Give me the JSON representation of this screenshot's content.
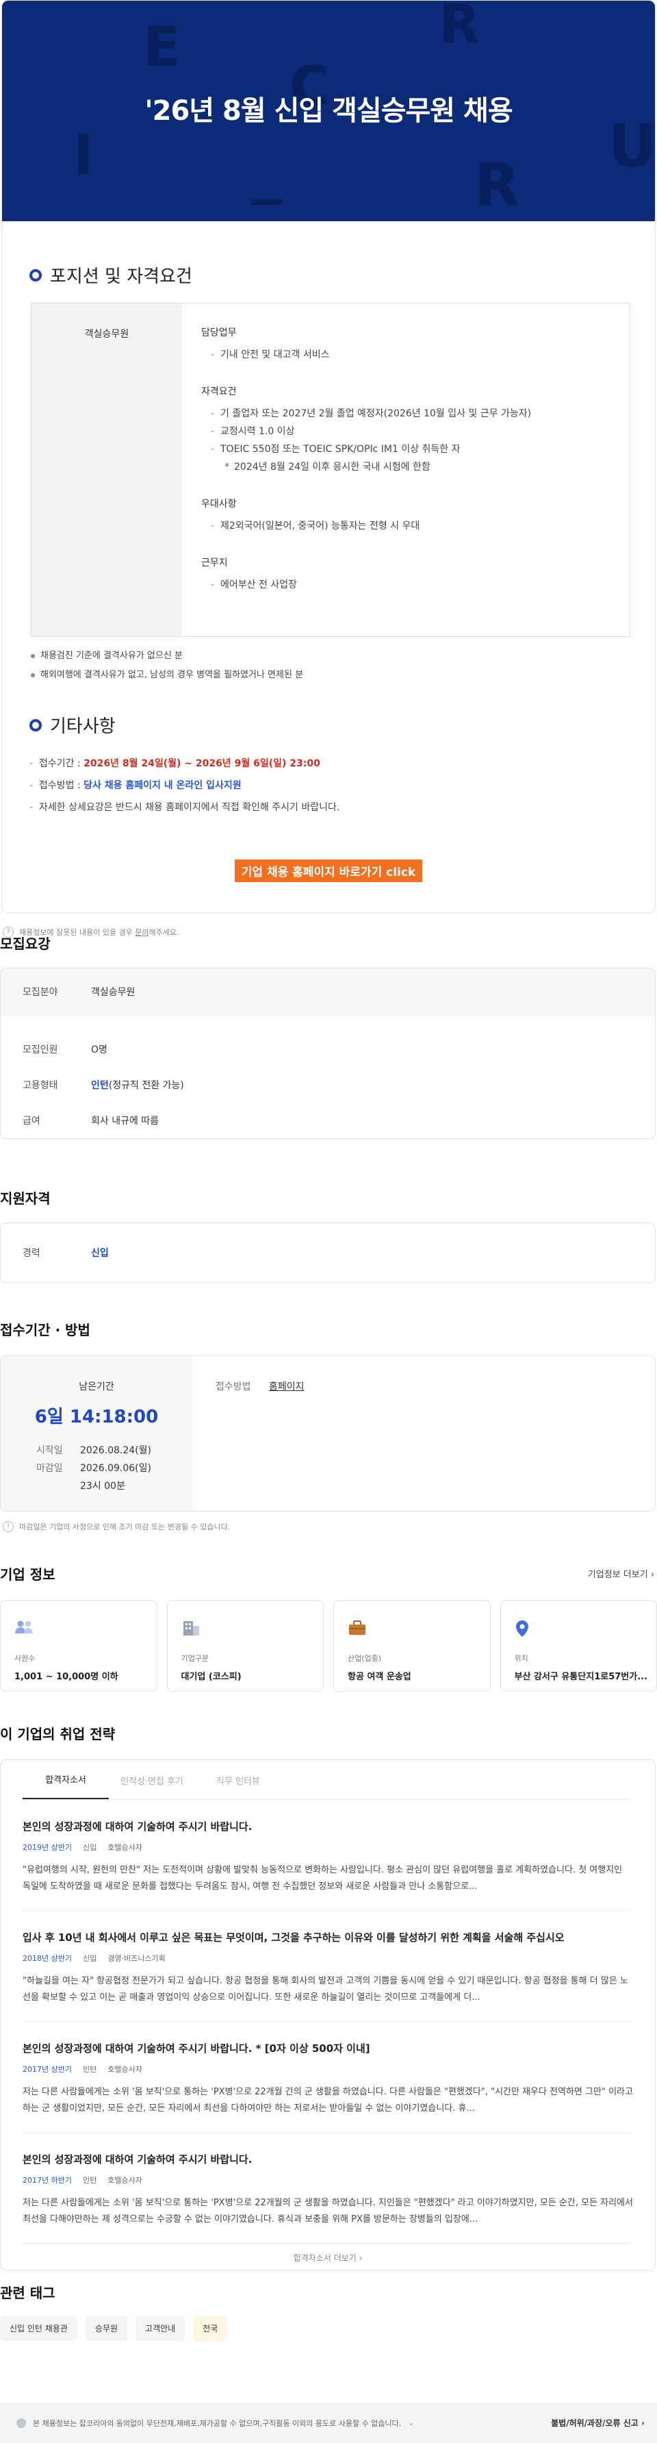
{
  "banner": {
    "title": "'26년 8월 신입 객실승무원 채용",
    "deco_letters": [
      "E",
      "R",
      "C",
      "I",
      "U",
      "R"
    ]
  },
  "positions": {
    "heading": "포지션 및 자격요건",
    "job_name": "객실승무원",
    "duty_title": "담당업무",
    "duty_items": [
      "기내 안전 및 대고객 서비스"
    ],
    "req_title": "자격요건",
    "req_items": [
      "기 졸업자 또는 2027년 2월 졸업 예정자(2026년 10월 입사 및 근무 가능자)",
      "교정시력 1.0 이상",
      "TOEIC 550점 또는 TOEIC SPK/OPIc IM1 이상 취득한 자"
    ],
    "req_sub": "2024년 8월 24일 이후 응시한 국내 시험에 한함",
    "pref_title": "우대사항",
    "pref_items": [
      "제2외국어(일본어, 중국어) 능통자는 전형 시 우대"
    ],
    "loc_title": "근무지",
    "loc_items": [
      "에어부산 전 사업장"
    ],
    "notes": [
      "채용검진 기준에 결격사유가 없으신 분",
      "해외여행에 결격사유가 없고, 남성의 경우 병역을 필하였거나 면제된 분"
    ]
  },
  "etc": {
    "heading": "기타사항",
    "period_label": "접수기간 : ",
    "period_value": "2026년 8월 24일(월) ~ 2026년 9월 6일(일) 23:00",
    "method_label": "접수방법 : ",
    "method_value": "당사 채용 홈페이지 내 온라인 입사지원",
    "detail": "자세한 상세요강은 반드시 채용 홈페이지에서 직접 확인해 주시기 바랍니다.",
    "cta": "기업 채용 홈페이지 바로가기 click"
  },
  "report_line": {
    "pre": "채용정보에 잘못된 내용이 있을 경우 ",
    "link": "문의",
    "post": "해주세요."
  },
  "recruit": {
    "heading": "모집요강",
    "field_label": "모집분야",
    "field_value": "객실승무원",
    "rows": [
      {
        "k": "모집인원",
        "v": "O명"
      },
      {
        "k": "고용형태",
        "v_b": "인턴",
        "v": "(정규직 전환 가능)"
      },
      {
        "k": "급여",
        "v": "회사 내규에 따름"
      }
    ]
  },
  "qualification": {
    "heading": "지원자격",
    "k": "경력",
    "v": "신입"
  },
  "period": {
    "heading": "접수기간 · 방법",
    "remain_label": "남은기간",
    "remain_value": "6일 14:18:00",
    "start_label": "시작일",
    "start_value": "2026.08.24(월)",
    "end_label": "마감일",
    "end_value": "2026.09.06(일)",
    "end_time": "23시 00분",
    "method_label": "접수방법",
    "method_value": "홈페이지",
    "notice": "마감일은 기업의 사정으로 인해 조기 마감 또는 변경될 수 있습니다."
  },
  "company": {
    "heading": "기업 정보",
    "more": "기업정보 더보기",
    "cards": [
      {
        "icon": "people-icon",
        "label": "사원수",
        "value": "1,001 ~ 10,000명 이하"
      },
      {
        "icon": "building-icon",
        "label": "기업구분",
        "value": "대기업 (코스피)"
      },
      {
        "icon": "briefcase-icon",
        "label": "산업(업종)",
        "value": "항공 여객 운송업"
      },
      {
        "icon": "location-pin-icon",
        "label": "위치",
        "value": "부산 강서구 유통단지1로57번가..."
      }
    ]
  },
  "strategy": {
    "heading": "이 기업의 취업 전략",
    "tabs": [
      "합격자소서",
      "인적성·면접 후기",
      "직무 인터뷰"
    ],
    "articles": [
      {
        "title": "본인의 성장과정에 대하여 기술하여 주시기 바랍니다.",
        "year": "2019년 상반기",
        "type": "신입",
        "dept": "호텔승사자",
        "body": "\"유럽여행의 시작, 원헌의 만찬\" 저는 도전적이며 상황에 발맞춰 능동적으로 변화하는 사람입니다. 평소 관심이 많던 유럽여행을 홀로 계획하였습니다. 첫 여행지인 독일에 도착하였을 때 새로운 문화를 접했다는 두려움도 잠시, 여행 전 수집했던 정보와 새로운 사람들과 만나 소통함으로..."
      },
      {
        "title": "입사 후 10년 내 회사에서 이루고 싶은 목표는 무엇이며, 그것을 추구하는 이유와 이를 달성하기 위한 계획을 서술해 주십시오",
        "year": "2018년 상반기",
        "type": "신입",
        "dept": "경영·비즈니스기획",
        "body": "\"하늘길을 여는 자\" 항공협정 전문가가 되고 싶습니다. 항공 협정을 통해 회사의 발전과 고객의 기쁨을 동시에 얻을 수 있기 때문입니다. 항공 협정을 통해 더 많은 노선을 확보할 수 있고 이는 곧 매출과 영업이익 상승으로 이어집니다. 또한 새로운 하늘길이 열리는 것이므로 고객들에게 더..."
      },
      {
        "title": "본인의 성장과정에 대하여 기술하여 주시기 바랍니다. * [0자 이상 500자 이내]",
        "year": "2017년 상반기",
        "type": "인턴",
        "dept": "호텔승사자",
        "body": "저는 다른 사람들에게는 소위 '몸 보직'으로 통하는 'PX병'으로 22개월 간의 군 생활을 하였습니다. 다른 사람들은 \"편했겠다\", \"시간만 재우다 전역하면 그만\" 이라고 하는 군 생활이었지만, 모든 순간, 모든 자리에서 최선을 다하여야만 하는 저로서는 받아들일 수 없는 이야기였습니다. 휴..."
      },
      {
        "title": "본인의 성장과정에 대하여 기술하여 주시기 바랍니다.",
        "year": "2017년 하반기",
        "type": "인턴",
        "dept": "호텔승사자",
        "body": "저는 다른 사람들에게는 소위 '몸 보직'으로 통하는 'PX병'으로 22개월의 군 생활을 하였습니다. 지인들은 \"편했겠다\" 라고 이야기하였지만, 모든 순간, 모든 자리에서 최선을 다해야만하는 제 성격으로는 수긍할 수 없는 이야기였습니다. 휴식과 보충을 위해 PX를 방문하는 장병들의 입장에..."
      }
    ],
    "more": "합격자소서 더보기"
  },
  "tags": {
    "heading": "관련 태그",
    "items": [
      "신입 인턴 채용관",
      "승무원",
      "고객안내",
      "전국"
    ]
  },
  "footer": {
    "notice": "본 채용정보는 잡코리아의 동의없이 무단전재,재배포,재가공할 수 없으며,구직활동 이외의 용도로 사용할 수 없습니다.",
    "report": "불법/허위/과장/오류 신고"
  }
}
